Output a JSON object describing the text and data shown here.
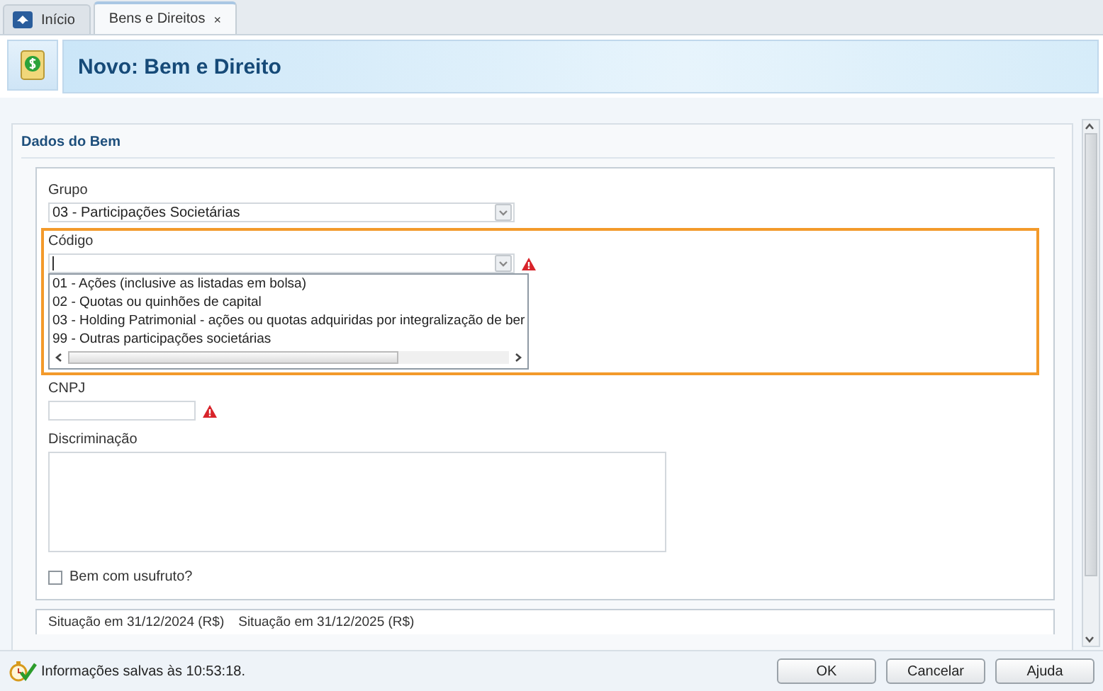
{
  "tabs": [
    {
      "label": "Início",
      "selected": false
    },
    {
      "label": "Bens e Direitos",
      "selected": true,
      "close": "×"
    }
  ],
  "header": {
    "title": "Novo: Bem e Direito"
  },
  "section": {
    "title": "Dados do Bem"
  },
  "fields": [
    {
      "kind": "select",
      "label": "Grupo",
      "value": "03 - Participações Societárias",
      "error": false,
      "highlighted": false
    },
    {
      "kind": "combo",
      "label": "Código",
      "error": true,
      "highlighted": true,
      "expanded": true,
      "options": [
        "01 - Ações (inclusive as listadas em bolsa)",
        "02 - Quotas ou quinhões de capital",
        "03 - Holding Patrimonial - ações ou quotas adquiridas por integralização de ber",
        "99 - Outras participações societárias"
      ]
    },
    {
      "kind": "text",
      "label": "CNPJ",
      "error": true,
      "highlighted": false
    },
    {
      "kind": "textarea",
      "label": "Discriminação",
      "error": false,
      "highlighted": false
    },
    {
      "kind": "checkbox",
      "label": "Bem com usufruto?",
      "checked": false
    }
  ],
  "values_panel": {
    "columns": [
      "Situação em 31/12/2024 (R$)",
      "Situação em 31/12/2025 (R$)"
    ]
  },
  "status_bar": {
    "message": "Informações salvas às 10:53:18."
  },
  "buttons": [
    "OK",
    "Cancelar",
    "Ajuda"
  ]
}
